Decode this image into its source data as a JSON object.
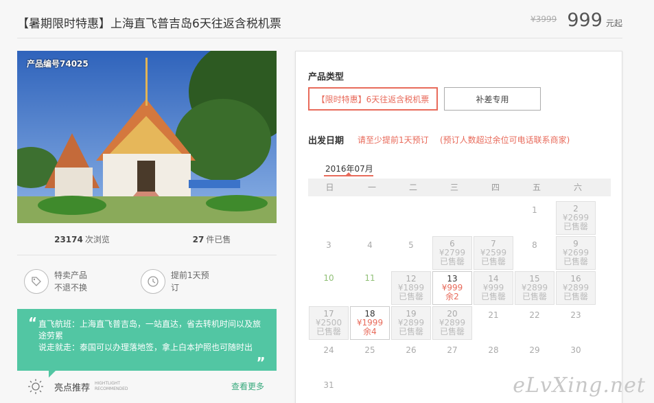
{
  "header": {
    "title": "【暑期限时特惠】上海直飞普吉岛6天往返含税机票",
    "old_price": "¥3999",
    "price": "999",
    "price_unit": "元起"
  },
  "left": {
    "product_no": "产品编号74025",
    "views_count": "23174",
    "views_label": "次浏览",
    "sold_count": "27",
    "sold_label": "件已售",
    "feature1_line1": "特卖产品",
    "feature1_line2": "不退不换",
    "feature2_line1": "提前1天预",
    "feature2_line2": "订",
    "quote_open": "“",
    "quote_close": "„",
    "quote_line1": "直飞航班：上海直飞普吉岛，一站直达，省去转机时间以及旅途劳累",
    "quote_line2": "说走就走：泰国可以办理落地签，拿上白本护照也可随时出",
    "highlight_title": "亮点推荐",
    "highlight_en1": "HIGHTLIGHT",
    "highlight_en2": "RECOMMENDED",
    "more_link": "查看更多"
  },
  "booking": {
    "type_label": "产品类型",
    "type_option_active": "【限时特惠】6天往返含税机票",
    "type_option_2": "补差专用",
    "date_label": "出发日期",
    "date_note1": "请至少提前1天预订",
    "date_note2": "(预订人数超过余位可电话联系商家)",
    "month": "2016年07月",
    "weekdays": [
      "日",
      "一",
      "二",
      "三",
      "四",
      "五",
      "六"
    ]
  },
  "calendar": [
    {
      "day": "1",
      "col": 5,
      "row": 0,
      "state": "plain"
    },
    {
      "day": "2",
      "col": 6,
      "row": 0,
      "state": "sold",
      "price": "¥2699",
      "status": "已售罄"
    },
    {
      "day": "3",
      "col": 0,
      "row": 1,
      "state": "plain"
    },
    {
      "day": "4",
      "col": 1,
      "row": 1,
      "state": "plain"
    },
    {
      "day": "5",
      "col": 2,
      "row": 1,
      "state": "plain"
    },
    {
      "day": "6",
      "col": 3,
      "row": 1,
      "state": "sold",
      "price": "¥2799",
      "status": "已售罄"
    },
    {
      "day": "7",
      "col": 4,
      "row": 1,
      "state": "sold",
      "price": "¥2599",
      "status": "已售罄"
    },
    {
      "day": "8",
      "col": 5,
      "row": 1,
      "state": "plain"
    },
    {
      "day": "9",
      "col": 6,
      "row": 1,
      "state": "sold",
      "price": "¥2699",
      "status": "已售罄"
    },
    {
      "day": "10",
      "col": 0,
      "row": 2,
      "state": "green"
    },
    {
      "day": "11",
      "col": 1,
      "row": 2,
      "state": "green"
    },
    {
      "day": "12",
      "col": 2,
      "row": 2,
      "state": "sold",
      "price": "¥1899",
      "status": "已售罄"
    },
    {
      "day": "13",
      "col": 3,
      "row": 2,
      "state": "avail",
      "price": "¥999",
      "status": "余2"
    },
    {
      "day": "14",
      "col": 4,
      "row": 2,
      "state": "sold",
      "price": "¥999",
      "status": "已售罄"
    },
    {
      "day": "15",
      "col": 5,
      "row": 2,
      "state": "sold",
      "price": "¥2899",
      "status": "已售罄"
    },
    {
      "day": "16",
      "col": 6,
      "row": 2,
      "state": "sold",
      "price": "¥2899",
      "status": "已售罄"
    },
    {
      "day": "17",
      "col": 0,
      "row": 3,
      "state": "sold",
      "price": "¥2500",
      "status": "已售罄"
    },
    {
      "day": "18",
      "col": 1,
      "row": 3,
      "state": "avail",
      "price": "¥1999",
      "status": "余4"
    },
    {
      "day": "19",
      "col": 2,
      "row": 3,
      "state": "sold",
      "price": "¥2899",
      "status": "已售罄"
    },
    {
      "day": "20",
      "col": 3,
      "row": 3,
      "state": "sold",
      "price": "¥2899",
      "status": "已售罄"
    },
    {
      "day": "21",
      "col": 4,
      "row": 3,
      "state": "plain"
    },
    {
      "day": "22",
      "col": 5,
      "row": 3,
      "state": "plain"
    },
    {
      "day": "23",
      "col": 6,
      "row": 3,
      "state": "plain"
    },
    {
      "day": "24",
      "col": 0,
      "row": 4,
      "state": "plain"
    },
    {
      "day": "25",
      "col": 1,
      "row": 4,
      "state": "plain"
    },
    {
      "day": "26",
      "col": 2,
      "row": 4,
      "state": "plain"
    },
    {
      "day": "27",
      "col": 3,
      "row": 4,
      "state": "plain"
    },
    {
      "day": "28",
      "col": 4,
      "row": 4,
      "state": "plain"
    },
    {
      "day": "29",
      "col": 5,
      "row": 4,
      "state": "plain"
    },
    {
      "day": "30",
      "col": 6,
      "row": 4,
      "state": "plain"
    },
    {
      "day": "31",
      "col": 0,
      "row": 5,
      "state": "plain"
    }
  ],
  "watermark": "eLvXing.net",
  "colors": {
    "accent": "#e86a5a",
    "green_panel": "#52c6a3",
    "link_green": "#3aaa7e"
  }
}
